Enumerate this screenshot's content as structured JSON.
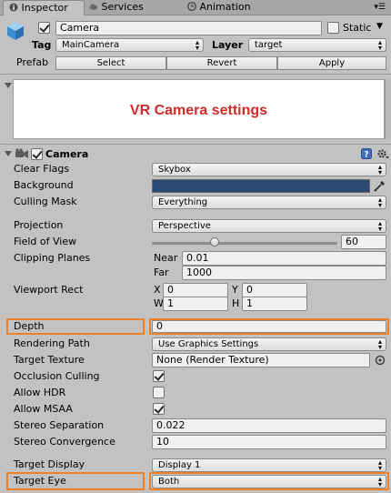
{
  "tabs": [
    {
      "label": "Inspector",
      "icon": "info-icon"
    },
    {
      "label": "Services",
      "icon": "cloud-icon"
    },
    {
      "label": "Animation",
      "icon": "clock-icon"
    }
  ],
  "header": {
    "object_name": "Camera",
    "static_label": "Static",
    "tag_label": "Tag",
    "tag_value": "MainCamera",
    "layer_label": "Layer",
    "layer_value": "target",
    "prefab_label": "Prefab",
    "prefab_buttons": [
      "Select",
      "Revert",
      "Apply"
    ]
  },
  "preview": {
    "text": "VR Camera settings"
  },
  "component": {
    "title": "Camera",
    "clear_flags": {
      "label": "Clear Flags",
      "value": "Skybox"
    },
    "background": {
      "label": "Background",
      "color": "#2b4a73"
    },
    "culling_mask": {
      "label": "Culling Mask",
      "value": "Everything"
    },
    "projection": {
      "label": "Projection",
      "value": "Perspective"
    },
    "field_of_view": {
      "label": "Field of View",
      "value": "60",
      "slider_fraction": 0.33
    },
    "clipping_planes": {
      "label": "Clipping Planes",
      "near_label": "Near",
      "near_value": "0.01",
      "far_label": "Far",
      "far_value": "1000"
    },
    "viewport_rect": {
      "label": "Viewport Rect",
      "x_label": "X",
      "x_value": "0",
      "y_label": "Y",
      "y_value": "0",
      "w_label": "W",
      "w_value": "1",
      "h_label": "H",
      "h_value": "1"
    },
    "depth": {
      "label": "Depth",
      "value": "0"
    },
    "rendering_path": {
      "label": "Rendering Path",
      "value": "Use Graphics Settings"
    },
    "target_texture": {
      "label": "Target Texture",
      "value": "None (Render Texture)"
    },
    "occlusion_culling": {
      "label": "Occlusion Culling",
      "checked": true
    },
    "allow_hdr": {
      "label": "Allow HDR",
      "checked": false
    },
    "allow_msaa": {
      "label": "Allow MSAA",
      "checked": true
    },
    "stereo_separation": {
      "label": "Stereo Separation",
      "value": "0.022"
    },
    "stereo_convergence": {
      "label": "Stereo Convergence",
      "value": "10"
    },
    "target_display": {
      "label": "Target Display",
      "value": "Display 1"
    },
    "target_eye": {
      "label": "Target Eye",
      "value": "Both"
    }
  },
  "colors": {
    "highlight": "#f08026",
    "preview_text": "#d42a28",
    "background_swatch": "#2b4a73"
  }
}
